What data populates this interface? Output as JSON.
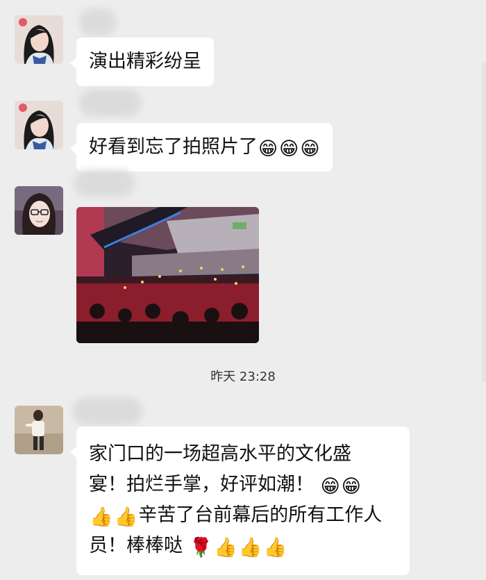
{
  "messages": [
    {
      "text": "演出精彩纷呈"
    },
    {
      "text": "好看到忘了拍照片了",
      "emojis": [
        "😁",
        "😁",
        "😁"
      ]
    },
    {
      "type": "image"
    },
    {
      "lines": [
        "家门口的一场超高水平的文化盛",
        "宴！拍烂手掌，好评如潮！",
        "辛苦了台前幕后的所有工作人",
        "员！棒棒哒"
      ],
      "emojis": {
        "line2": [
          "😁",
          "😁"
        ],
        "line3_lead": [
          "👍",
          "👍"
        ],
        "line4_tail": [
          "🌹",
          "👍",
          "👍",
          "👍"
        ]
      }
    }
  ],
  "timestamp": "昨天 23:28",
  "colors": {
    "background": "#ededed",
    "bubble": "#ffffff",
    "text": "#111111"
  },
  "icons": [
    "avatar-woman-icon",
    "avatar-glasses-icon",
    "avatar-person-icon",
    "grin-emoji-icon",
    "thumbs-up-emoji-icon",
    "rose-emoji-icon"
  ]
}
